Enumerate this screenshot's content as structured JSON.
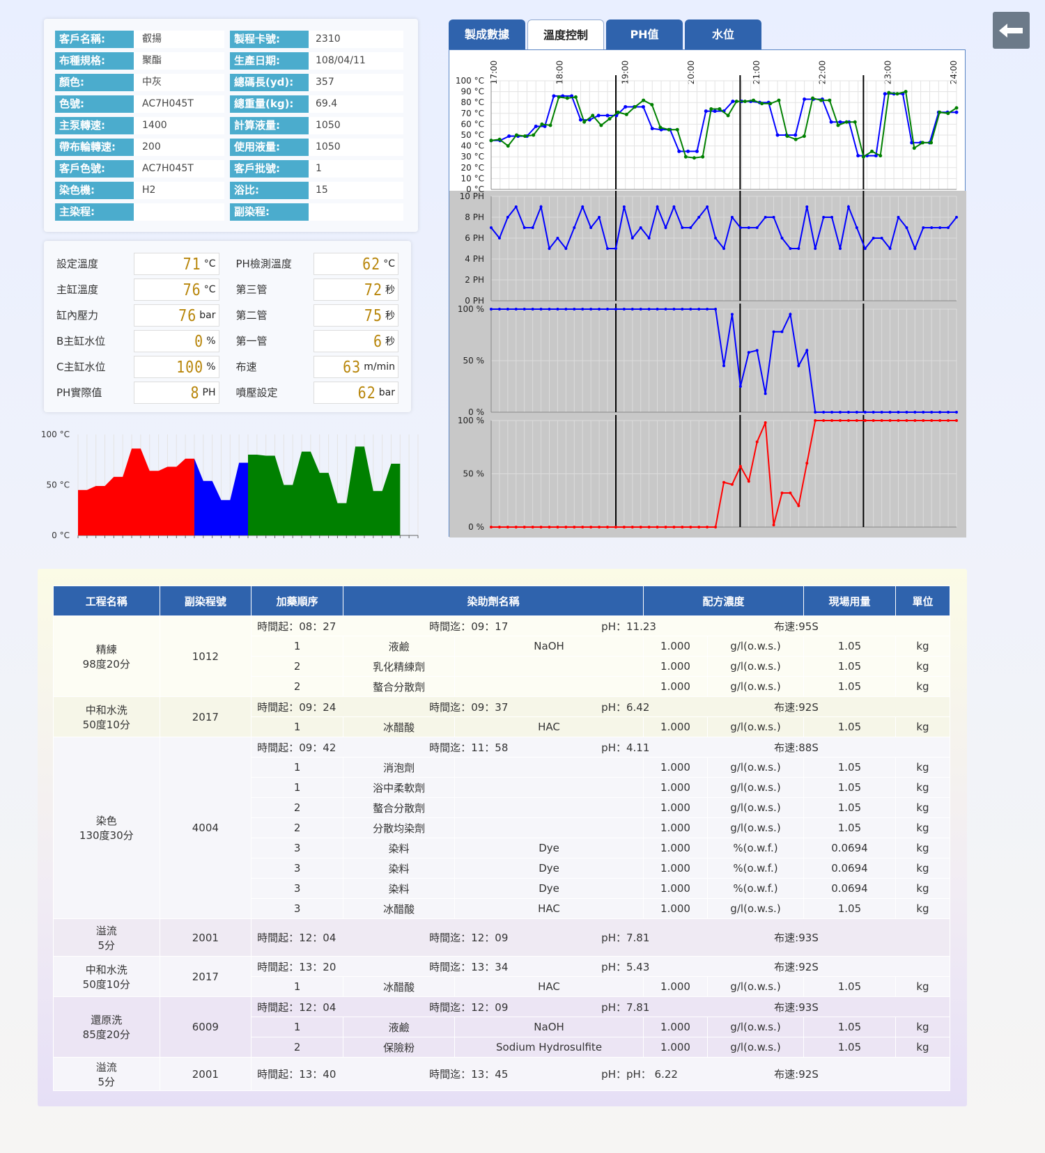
{
  "info": [
    {
      "l1": "客戶名稱:",
      "v1": "叡揚",
      "l2": "製程卡號:",
      "v2": "2310"
    },
    {
      "l1": "布種規格:",
      "v1": "聚酯",
      "l2": "生產日期:",
      "v2": "108/04/11"
    },
    {
      "l1": "顏色:",
      "v1": "中灰",
      "l2": "總碼長(yd):",
      "v2": "357"
    },
    {
      "l1": "色號:",
      "v1": "AC7H045T",
      "l2": "總重量(kg):",
      "v2": "69.4"
    },
    {
      "l1": "主泵轉速:",
      "v1": "1400",
      "l2": "計算液量:",
      "v2": "1050"
    },
    {
      "l1": "帶布輪轉速:",
      "v1": "200",
      "l2": "使用液量:",
      "v2": "1050"
    },
    {
      "l1": "客戶色號:",
      "v1": "AC7H045T",
      "l2": "客戶批號:",
      "v2": "1"
    },
    {
      "l1": "染色機:",
      "v1": "H2",
      "l2": "浴比:",
      "v2": "15"
    },
    {
      "l1": "主染程:",
      "v1": "",
      "l2": "副染程:",
      "v2": ""
    }
  ],
  "gauges": [
    {
      "l1": "設定溫度",
      "n1": "71",
      "u1": "°C",
      "l2": "PH檢測溫度",
      "n2": "62",
      "u2": "°C"
    },
    {
      "l1": "主缸溫度",
      "n1": "76",
      "u1": "°C",
      "l2": "第三管",
      "n2": "72",
      "u2": "秒"
    },
    {
      "l1": "缸內壓力",
      "n1": "76",
      "u1": "bar",
      "l2": "第二管",
      "n2": "75",
      "u2": "秒"
    },
    {
      "l1": "B主缸水位",
      "n1": "0",
      "u1": "%",
      "l2": "第一管",
      "n2": "6",
      "u2": "秒"
    },
    {
      "l1": "C主缸水位",
      "n1": "100",
      "u1": "%",
      "l2": "布速",
      "n2": "63",
      "u2": "m/min"
    },
    {
      "l1": "PH實際值",
      "n1": "8",
      "u1": "PH",
      "l2": "噴壓設定",
      "n2": "62",
      "u2": "bar"
    }
  ],
  "tabs": [
    "製成數據",
    "溫度控制",
    "PH值",
    "水位"
  ],
  "back_icon": "arrow-left-icon",
  "chart_data": [
    {
      "type": "area",
      "name": "bar-area-chart",
      "y_ticks": [
        "100 °C",
        "50 °C",
        "0 °C"
      ],
      "ylim": [
        0,
        100
      ],
      "colors": [
        "#ff0000",
        "#0000ff",
        "#008000"
      ],
      "segments": [
        {
          "color": "#ff0000",
          "values": [
            45,
            45,
            49,
            49,
            58,
            58,
            86,
            86,
            64,
            64,
            68,
            68,
            76,
            76
          ]
        },
        {
          "color": "#0000ff",
          "values": [
            76,
            54,
            54,
            35,
            35,
            72,
            72
          ]
        },
        {
          "color": "#008000",
          "values": [
            80,
            80,
            79,
            79,
            50,
            50,
            83,
            83,
            62,
            62,
            32,
            32,
            88,
            88,
            44,
            44,
            71,
            71
          ]
        }
      ]
    },
    {
      "type": "line",
      "name": "temperature-chart",
      "x_ticks": [
        "17:00",
        "18:00",
        "19:00",
        "20:00",
        "21:00",
        "22:00",
        "23:00",
        "24:00"
      ],
      "y_ticks": [
        "100 °C",
        "90 °C",
        "80 °C",
        "70 °C",
        "60 °C",
        "50 °C",
        "40 °C",
        "30 °C",
        "20 °C",
        "10 °C",
        "0 °C"
      ],
      "ylim": [
        0,
        100
      ],
      "series": [
        {
          "color": "#0000ff",
          "values": [
            45,
            45,
            49,
            49,
            49,
            58,
            58,
            86,
            86,
            86,
            64,
            64,
            68,
            68,
            68,
            76,
            76,
            76,
            56,
            55,
            55,
            35,
            35,
            35,
            72,
            72,
            72,
            81,
            81,
            81,
            80,
            80,
            50,
            50,
            50,
            83,
            83,
            83,
            62,
            62,
            62,
            31,
            31,
            31,
            88,
            88,
            88,
            43,
            43,
            43,
            71,
            71,
            71
          ]
        },
        {
          "color": "#008000",
          "values": [
            45,
            46,
            40,
            50,
            49,
            50,
            60,
            59,
            85,
            84,
            85,
            62,
            68,
            59,
            65,
            71,
            69,
            76,
            82,
            78,
            57,
            55,
            55,
            30,
            29,
            30,
            74,
            74,
            68,
            81,
            81,
            82,
            79,
            79,
            82,
            49,
            46,
            49,
            84,
            82,
            82,
            59,
            62,
            62,
            30,
            35,
            31,
            89,
            88,
            90,
            38,
            43,
            43,
            71,
            70,
            75
          ]
        }
      ]
    },
    {
      "type": "line",
      "name": "ph-chart",
      "y_ticks": [
        "10 PH",
        "8 PH",
        "6 PH",
        "4 PH",
        "2 PH",
        "0 PH"
      ],
      "ylim": [
        0,
        10
      ],
      "series": [
        {
          "color": "#0000ff",
          "values": [
            7,
            6,
            8,
            9,
            7,
            7,
            9,
            5,
            6,
            5,
            7,
            9,
            7,
            8,
            5,
            5,
            9,
            6,
            7,
            6,
            9,
            7,
            9,
            7,
            7,
            8,
            9,
            6,
            5,
            8,
            7,
            7,
            7,
            8,
            8,
            6,
            5,
            5,
            9,
            5,
            8,
            8,
            5,
            9,
            7,
            5,
            6,
            6,
            5,
            8,
            7,
            5,
            7,
            7,
            7,
            7,
            8
          ]
        }
      ]
    },
    {
      "type": "line",
      "name": "water-level-b-chart",
      "y_ticks": [
        "100 %",
        "50 %",
        "0 %"
      ],
      "ylim": [
        0,
        100
      ],
      "series": [
        {
          "color": "#0000ff",
          "values": [
            100,
            100,
            100,
            100,
            100,
            100,
            100,
            100,
            100,
            100,
            100,
            100,
            100,
            100,
            100,
            100,
            100,
            100,
            100,
            100,
            100,
            100,
            100,
            100,
            100,
            100,
            100,
            100,
            45,
            95,
            25,
            58,
            60,
            18,
            78,
            78,
            95,
            45,
            60,
            0,
            0,
            0,
            0,
            0,
            0,
            0,
            0,
            0,
            0,
            0,
            0,
            0,
            0,
            0,
            0,
            0,
            0
          ]
        }
      ]
    },
    {
      "type": "line",
      "name": "water-level-c-chart",
      "y_ticks": [
        "100 %",
        "50 %",
        "0 %"
      ],
      "ylim": [
        0,
        100
      ],
      "series": [
        {
          "color": "#ff0000",
          "values": [
            0,
            0,
            0,
            0,
            0,
            0,
            0,
            0,
            0,
            0,
            0,
            0,
            0,
            0,
            0,
            0,
            0,
            0,
            0,
            0,
            0,
            0,
            0,
            0,
            0,
            0,
            0,
            0,
            42,
            40,
            57,
            43,
            80,
            98,
            2,
            32,
            32,
            20,
            60,
            100,
            100,
            100,
            100,
            100,
            100,
            100,
            100,
            100,
            100,
            100,
            100,
            100,
            100,
            100,
            100,
            100,
            100
          ]
        }
      ]
    }
  ],
  "table": {
    "headers": [
      "工程名稱",
      "副染程號",
      "加藥順序",
      "染助劑名稱",
      "配方濃度",
      "現場用量",
      "單位"
    ],
    "labels": {
      "start": "時間起：",
      "end": "時間迄：",
      "ph": "pH：",
      "speed": "布速:"
    },
    "groups": [
      {
        "name": "精練",
        "sub": "98度20分",
        "code": "1012",
        "start": "08：27",
        "end": "09：17",
        "ph": "11.23",
        "speed": "95S",
        "items": [
          {
            "order": "1",
            "agent": "液鹼",
            "chem": "NaOH",
            "conc": "1.000",
            "cunit": "g/l(o.w.s.)",
            "qty": "1.05",
            "unit": "kg"
          },
          {
            "order": "2",
            "agent": "乳化精練劑",
            "chem": "",
            "conc": "1.000",
            "cunit": "g/l(o.w.s.)",
            "qty": "1.05",
            "unit": "kg"
          },
          {
            "order": "2",
            "agent": "螯合分散劑",
            "chem": "",
            "conc": "1.000",
            "cunit": "g/l(o.w.s.)",
            "qty": "1.05",
            "unit": "kg"
          }
        ]
      },
      {
        "name": "中和水洗",
        "sub": "50度10分",
        "code": "2017",
        "start": "09：24",
        "end": "09：37",
        "ph": "6.42",
        "speed": "92S",
        "items": [
          {
            "order": "1",
            "agent": "冰醋酸",
            "chem": "HAC",
            "conc": "1.000",
            "cunit": "g/l(o.w.s.)",
            "qty": "1.05",
            "unit": "kg"
          }
        ]
      },
      {
        "name": "染色",
        "sub": "130度30分",
        "code": "4004",
        "start": "09：42",
        "end": "11：58",
        "ph": "4.11",
        "speed": "88S",
        "items": [
          {
            "order": "1",
            "agent": "消泡劑",
            "chem": "",
            "conc": "1.000",
            "cunit": "g/l(o.w.s.)",
            "qty": "1.05",
            "unit": "kg"
          },
          {
            "order": "1",
            "agent": "浴中柔軟劑",
            "chem": "",
            "conc": "1.000",
            "cunit": "g/l(o.w.s.)",
            "qty": "1.05",
            "unit": "kg"
          },
          {
            "order": "2",
            "agent": "螯合分散劑",
            "chem": "",
            "conc": "1.000",
            "cunit": "g/l(o.w.s.)",
            "qty": "1.05",
            "unit": "kg"
          },
          {
            "order": "2",
            "agent": "分散均染劑",
            "chem": "",
            "conc": "1.000",
            "cunit": "g/l(o.w.s.)",
            "qty": "1.05",
            "unit": "kg"
          },
          {
            "order": "3",
            "agent": "染料",
            "chem": "Dye",
            "conc": "1.000",
            "cunit": "%(o.w.f.)",
            "qty": "0.0694",
            "unit": "kg"
          },
          {
            "order": "3",
            "agent": "染料",
            "chem": "Dye",
            "conc": "1.000",
            "cunit": "%(o.w.f.)",
            "qty": "0.0694",
            "unit": "kg"
          },
          {
            "order": "3",
            "agent": "染料",
            "chem": "Dye",
            "conc": "1.000",
            "cunit": "%(o.w.f.)",
            "qty": "0.0694",
            "unit": "kg"
          },
          {
            "order": "3",
            "agent": "冰醋酸",
            "chem": "HAC",
            "conc": "1.000",
            "cunit": "g/l(o.w.s.)",
            "qty": "1.05",
            "unit": "kg"
          }
        ]
      },
      {
        "name": "溢流",
        "sub": "5分",
        "code": "2001",
        "start": "12：04",
        "end": "12：09",
        "ph": "7.81",
        "speed": "93S",
        "items": []
      },
      {
        "name": "中和水洗",
        "sub": "50度10分",
        "code": "2017",
        "start": "13：20",
        "end": "13：34",
        "ph": "5.43",
        "speed": "92S",
        "items": [
          {
            "order": "1",
            "agent": "冰醋酸",
            "chem": "HAC",
            "conc": "1.000",
            "cunit": "g/l(o.w.s.)",
            "qty": "1.05",
            "unit": "kg"
          }
        ]
      },
      {
        "name": "還原洗",
        "sub": "85度20分",
        "code": "6009",
        "start": "12：04",
        "end": "12：09",
        "ph": "7.81",
        "speed": "93S",
        "items": [
          {
            "order": "1",
            "agent": "液鹼",
            "chem": "NaOH",
            "conc": "1.000",
            "cunit": "g/l(o.w.s.)",
            "qty": "1.05",
            "unit": "kg"
          },
          {
            "order": "2",
            "agent": "保險粉",
            "chem": "Sodium Hydrosulfite",
            "conc": "1.000",
            "cunit": "g/l(o.w.s.)",
            "qty": "1.05",
            "unit": "kg"
          }
        ]
      },
      {
        "name": "溢流",
        "sub": "5分",
        "code": "2001",
        "start": "13：40",
        "end": "13：45",
        "ph": "pH： 6.22",
        "speed": "92S",
        "items": []
      }
    ]
  }
}
